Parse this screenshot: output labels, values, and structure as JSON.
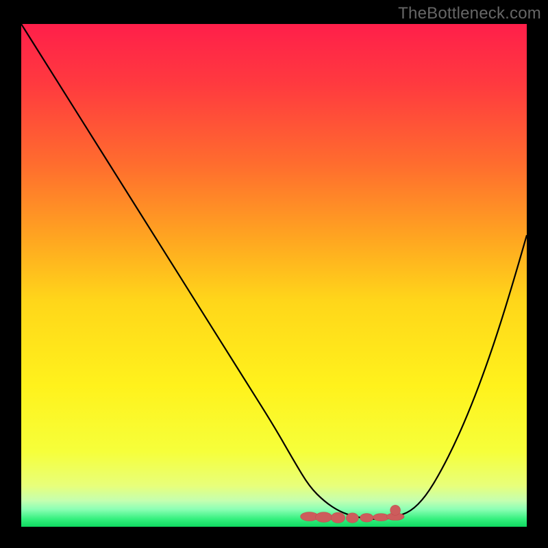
{
  "watermark": "TheBottleneck.com",
  "colors": {
    "curve_stroke": "#000000",
    "marker_fill": "#cd5c5c",
    "marker_stroke": "#c14f4f",
    "background": "#000000"
  },
  "gradient_stops": [
    {
      "offset": 0.0,
      "color": "#ff1f4a"
    },
    {
      "offset": 0.12,
      "color": "#ff3a3f"
    },
    {
      "offset": 0.28,
      "color": "#ff6d2e"
    },
    {
      "offset": 0.42,
      "color": "#ffa321"
    },
    {
      "offset": 0.55,
      "color": "#ffd61a"
    },
    {
      "offset": 0.72,
      "color": "#fff21c"
    },
    {
      "offset": 0.85,
      "color": "#f6ff3a"
    },
    {
      "offset": 0.918,
      "color": "#e8ff7a"
    },
    {
      "offset": 0.948,
      "color": "#c5ffb0"
    },
    {
      "offset": 0.965,
      "color": "#8cffb5"
    },
    {
      "offset": 0.985,
      "color": "#33f07d"
    },
    {
      "offset": 1.0,
      "color": "#0fd860"
    }
  ],
  "chart_data": {
    "type": "line",
    "title": "",
    "xlabel": "",
    "ylabel": "",
    "xlim": [
      0,
      100
    ],
    "ylim": [
      0,
      100
    ],
    "x": [
      0,
      5,
      10,
      15,
      20,
      25,
      30,
      35,
      40,
      45,
      50,
      54,
      57,
      60,
      63,
      66,
      69,
      72,
      74,
      77,
      80,
      83,
      86,
      89,
      92,
      95,
      98,
      100
    ],
    "values": [
      100,
      92,
      84,
      76,
      68,
      60,
      52,
      44,
      36,
      28,
      20,
      13,
      8,
      5,
      3,
      2,
      1.5,
      1.5,
      2,
      3,
      6,
      11,
      17,
      24,
      32,
      41,
      51,
      58
    ],
    "optimal_zone": {
      "x_start": 57,
      "x_end": 74,
      "y": 1.9
    },
    "optimal_marker_dot": {
      "x": 74,
      "y": 2.2,
      "r": 1.2
    }
  }
}
